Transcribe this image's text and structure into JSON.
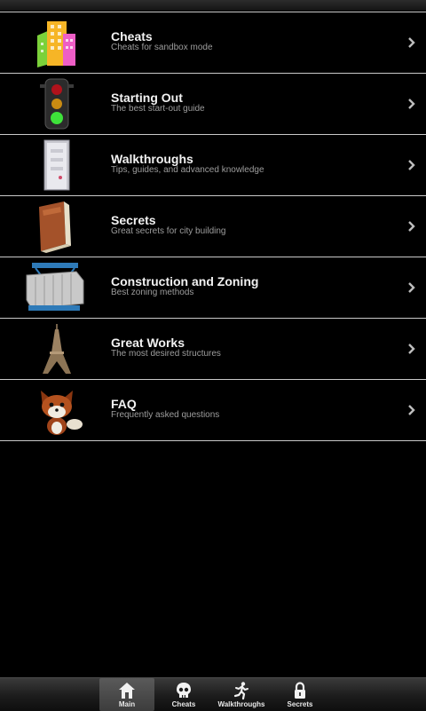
{
  "menu": {
    "items": [
      {
        "title": "Cheats",
        "subtitle": "Cheats for sandbox mode",
        "icon": "city-buildings-icon"
      },
      {
        "title": "Starting Out",
        "subtitle": "The best start-out guide",
        "icon": "traffic-light-icon"
      },
      {
        "title": "Walkthroughs",
        "subtitle": "Tips, guides, and advanced knowledge",
        "icon": "door-icon"
      },
      {
        "title": "Secrets",
        "subtitle": "Great secrets for city building",
        "icon": "book-icon"
      },
      {
        "title": "Construction and Zoning",
        "subtitle": "Best zoning methods",
        "icon": "shipping-container-icon"
      },
      {
        "title": "Great Works",
        "subtitle": "The most desired structures",
        "icon": "eiffel-tower-icon"
      },
      {
        "title": "FAQ",
        "subtitle": "Frequently asked questions",
        "icon": "fox-icon"
      }
    ]
  },
  "tabbar": {
    "tabs": [
      {
        "label": "Main",
        "icon": "home-icon",
        "active": true
      },
      {
        "label": "Cheats",
        "icon": "skull-icon",
        "active": false
      },
      {
        "label": "Walkthroughs",
        "icon": "running-man-icon",
        "active": false
      },
      {
        "label": "Secrets",
        "icon": "lock-icon",
        "active": false
      }
    ]
  },
  "colors": {
    "background": "#000000",
    "divider": "#c9c9c9",
    "title": "#f2f2f2",
    "subtitle": "#9d9d9d"
  }
}
